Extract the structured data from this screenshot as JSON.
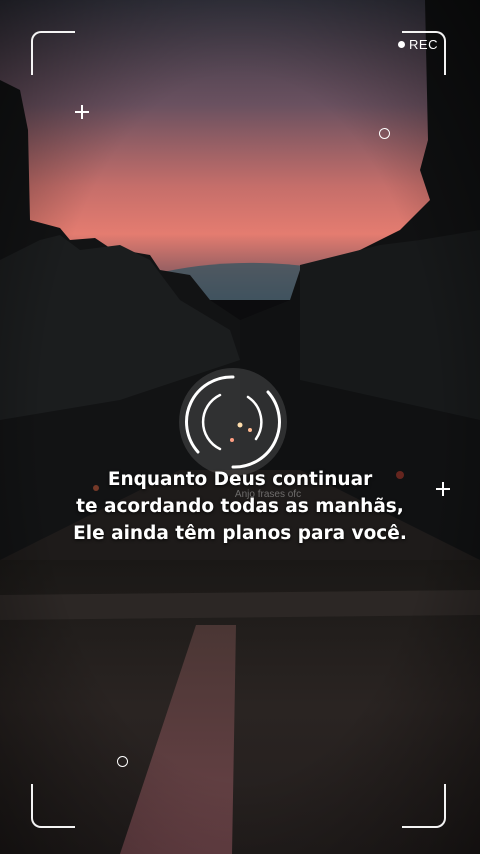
{
  "recording": {
    "label": "REC"
  },
  "quote": {
    "lines": [
      "Enquanto Deus continuar",
      "te acordando todas as manhãs,",
      "Ele ainda têm planos para você."
    ]
  },
  "watermark": "Anjo frases ofc",
  "icons": {
    "rec_indicator": "record-dot-icon",
    "focus": "focus-reticle-icon",
    "crosshair": "plus-icon",
    "marker": "small-ring-icon"
  },
  "colors": {
    "sky_top": "#3a3a4a",
    "sky_glow": "#e0786a",
    "overlay": "#ffffff"
  }
}
